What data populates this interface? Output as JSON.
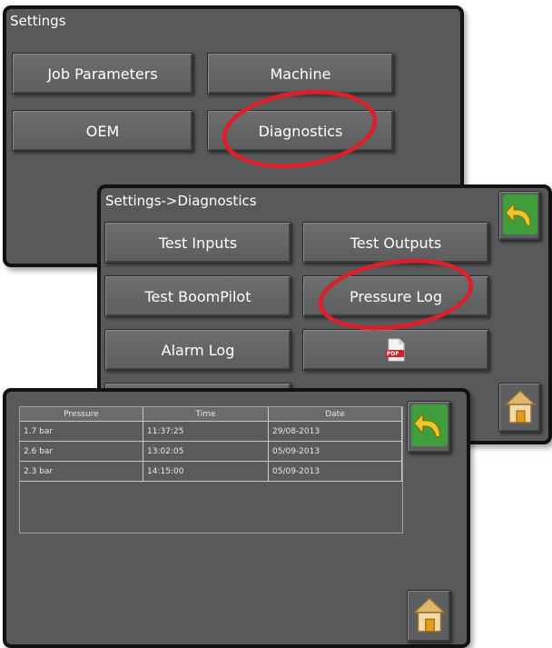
{
  "settings": {
    "title": "Settings",
    "buttons": {
      "job_parameters": "Job Parameters",
      "machine": "Machine",
      "oem": "OEM",
      "diagnostics": "Diagnostics"
    }
  },
  "diagnostics": {
    "title": "Settings->Diagnostics",
    "buttons": {
      "test_inputs": "Test Inputs",
      "test_outputs": "Test Outputs",
      "test_boompilot": "Test BoomPilot",
      "pressure_log": "Pressure Log",
      "alarm_log": "Alarm Log"
    },
    "pdf_icon_label": "PDF"
  },
  "pressure_log": {
    "columns": [
      "Pressure",
      "Time",
      "Date"
    ],
    "rows": [
      [
        "1.7 bar",
        "11:37:25",
        "29/08-2013"
      ],
      [
        "2.6 bar",
        "13:02:05",
        "05/09-2013"
      ],
      [
        "2.3 bar",
        "14:15:00",
        "05/09-2013"
      ]
    ]
  },
  "icons": {
    "back": "back-arrow-icon",
    "home": "home-icon",
    "pdf": "pdf-icon"
  },
  "colors": {
    "panel_bg": "#58595b",
    "panel_border": "#121212",
    "highlight_ring": "#d8212a",
    "back_arrow": "#f0c52a",
    "back_button_bg": "#3f9d3c"
  }
}
